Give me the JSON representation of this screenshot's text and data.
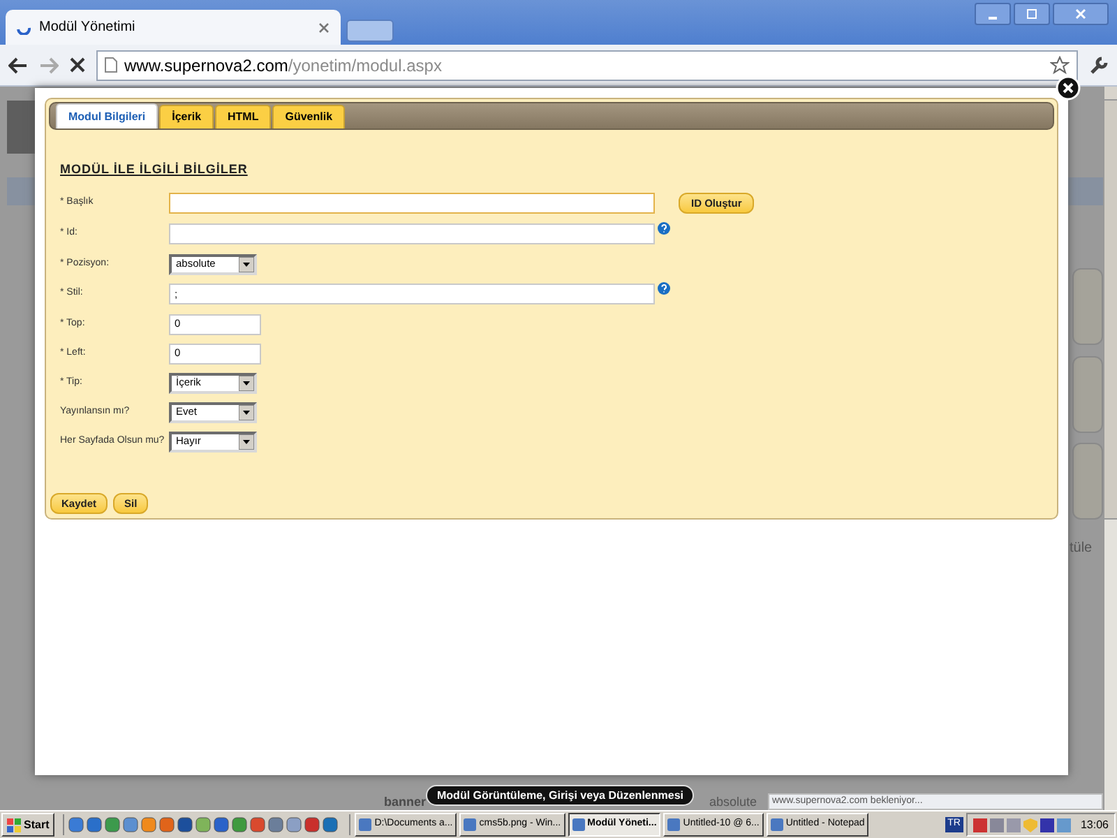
{
  "browser": {
    "tab_title": "Modül Yönetimi",
    "url_host": "www.supernova2.com",
    "url_path": "/yonetim/modul.aspx"
  },
  "modal": {
    "tabs": [
      {
        "label": "Modul Bilgileri",
        "selected": true
      },
      {
        "label": "İçerik",
        "selected": false
      },
      {
        "label": "HTML",
        "selected": false
      },
      {
        "label": "Güvenlik",
        "selected": false
      }
    ],
    "heading": "MODÜL İLE İLGİLİ BİLGİLER",
    "fields": [
      {
        "label": "* Başlık",
        "kind": "wide_text",
        "focused": true,
        "help": false,
        "button": "ID Oluştur"
      },
      {
        "label": "* Id:",
        "kind": "wide_text",
        "focused": false,
        "help": true
      },
      {
        "label": "* Pozisyon:",
        "kind": "select",
        "value": "absolute"
      },
      {
        "label": "* Stil:",
        "kind": "wide_text",
        "value": ";",
        "focused": false,
        "help": true
      },
      {
        "label": "* Top:",
        "kind": "short_text",
        "value": "0",
        "focused": false
      },
      {
        "label": "* Left:",
        "kind": "short_text",
        "value": "0",
        "focused": false
      },
      {
        "label": "* Tip:",
        "kind": "select",
        "value": "İçerik"
      },
      {
        "label": "Yayınlansın mı?",
        "kind": "select",
        "value": "Evet"
      },
      {
        "label": "Her Sayfada Olsun mu?",
        "kind": "select",
        "value": "Hayır"
      }
    ],
    "actions": [
      "Kaydet",
      "Sil"
    ]
  },
  "background": {
    "column_header": "tüle",
    "row_cells": [
      "banner",
      "absolute"
    ]
  },
  "tooltip": "Modül Görüntüleme, Girişi veya Düzenlenmesi",
  "status": "www.supernova2.com bekleniyor...",
  "taskbar": {
    "start": "Start",
    "tasks": [
      {
        "label": "D:\\Documents a...",
        "selected": false
      },
      {
        "label": "cms5b.png - Win...",
        "selected": false
      },
      {
        "label": "Modül Yöneti...",
        "selected": true
      },
      {
        "label": "Untitled-10 @ 6...",
        "selected": false
      },
      {
        "label": "Untitled - Notepad",
        "selected": false
      }
    ],
    "language": "TR",
    "clock": "13:06"
  }
}
